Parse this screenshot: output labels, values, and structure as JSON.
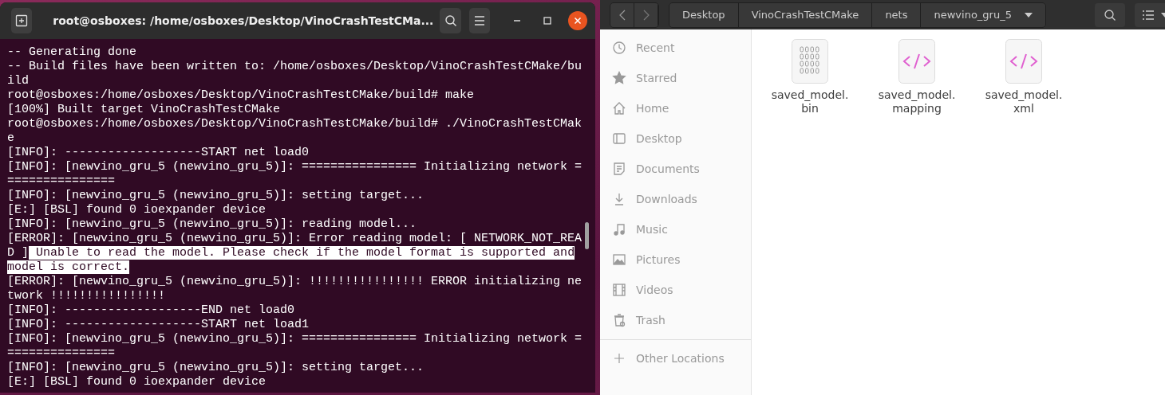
{
  "terminal": {
    "title": "root@osboxes: /home/osboxes/Desktop/VinoCrashTestCMa...",
    "lines": [
      {
        "segments": [
          {
            "text": "-- Generating done",
            "selected": false
          }
        ]
      },
      {
        "segments": [
          {
            "text": "-- Build files have been written to: /home/osboxes/Desktop/VinoCrashTestCMake/bu",
            "selected": false
          }
        ]
      },
      {
        "segments": [
          {
            "text": "ild",
            "selected": false
          }
        ]
      },
      {
        "segments": [
          {
            "text": "root@osboxes:/home/osboxes/Desktop/VinoCrashTestCMake/build# make",
            "selected": false
          }
        ]
      },
      {
        "segments": [
          {
            "text": "[100%] Built target VinoCrashTestCMake",
            "selected": false
          }
        ]
      },
      {
        "segments": [
          {
            "text": "root@osboxes:/home/osboxes/Desktop/VinoCrashTestCMake/build# ./VinoCrashTestCMak",
            "selected": false
          }
        ]
      },
      {
        "segments": [
          {
            "text": "e",
            "selected": false
          }
        ]
      },
      {
        "segments": [
          {
            "text": "[INFO]: -------------------START net load0",
            "selected": false
          }
        ]
      },
      {
        "segments": [
          {
            "text": "[INFO]: [newvino_gru_5 (newvino_gru_5)]: ================ Initializing network =",
            "selected": false
          }
        ]
      },
      {
        "segments": [
          {
            "text": "===============",
            "selected": false
          }
        ]
      },
      {
        "segments": [
          {
            "text": "[INFO]: [newvino_gru_5 (newvino_gru_5)]: setting target...",
            "selected": false
          }
        ]
      },
      {
        "segments": [
          {
            "text": "[E:] [BSL] found 0 ioexpander device",
            "selected": false
          }
        ]
      },
      {
        "segments": [
          {
            "text": "[INFO]: [newvino_gru_5 (newvino_gru_5)]: reading model...",
            "selected": false
          }
        ]
      },
      {
        "segments": [
          {
            "text": "[ERROR]: [newvino_gru_5 (newvino_gru_5)]: Error reading model: [ NETWORK_NOT_REA",
            "selected": false
          }
        ]
      },
      {
        "segments": [
          {
            "text": "D ]",
            "selected": false
          },
          {
            "text": " Unable to read the model. Please check if the model format is supported and",
            "selected": true
          }
        ]
      },
      {
        "segments": [
          {
            "text": "model is correct.",
            "selected": true
          }
        ]
      },
      {
        "segments": [
          {
            "text": "[ERROR]: [newvino_gru_5 (newvino_gru_5)]: !!!!!!!!!!!!!!!! ERROR initializing ne",
            "selected": false
          }
        ]
      },
      {
        "segments": [
          {
            "text": "twork !!!!!!!!!!!!!!!!",
            "selected": false
          }
        ]
      },
      {
        "segments": [
          {
            "text": "[INFO]: -------------------END net load0",
            "selected": false
          }
        ]
      },
      {
        "segments": [
          {
            "text": "[INFO]: -------------------START net load1",
            "selected": false
          }
        ]
      },
      {
        "segments": [
          {
            "text": "[INFO]: [newvino_gru_5 (newvino_gru_5)]: ================ Initializing network =",
            "selected": false
          }
        ]
      },
      {
        "segments": [
          {
            "text": "===============",
            "selected": false
          }
        ]
      },
      {
        "segments": [
          {
            "text": "[INFO]: [newvino_gru_5 (newvino_gru_5)]: setting target...",
            "selected": false
          }
        ]
      },
      {
        "segments": [
          {
            "text": "[E:] [BSL] found 0 ioexpander device",
            "selected": false
          }
        ]
      }
    ]
  },
  "files": {
    "path": [
      "Desktop",
      "VinoCrashTestCMake",
      "nets",
      "newvino_gru_5"
    ],
    "sidebar": [
      {
        "label": "Recent",
        "kind": "recent"
      },
      {
        "label": "Starred",
        "kind": "starred"
      },
      {
        "label": "Home",
        "kind": "home"
      },
      {
        "label": "Desktop",
        "kind": "desktop"
      },
      {
        "label": "Documents",
        "kind": "documents"
      },
      {
        "label": "Downloads",
        "kind": "downloads"
      },
      {
        "label": "Music",
        "kind": "music"
      },
      {
        "label": "Pictures",
        "kind": "pictures"
      },
      {
        "label": "Videos",
        "kind": "videos"
      },
      {
        "label": "Trash",
        "kind": "trash"
      }
    ],
    "other_locations": "Other Locations",
    "items": [
      {
        "name": "saved_model.\nbin",
        "kind": "binary"
      },
      {
        "name": "saved_model.\nmapping",
        "kind": "markup"
      },
      {
        "name": "saved_model.\nxml",
        "kind": "markup"
      }
    ]
  }
}
